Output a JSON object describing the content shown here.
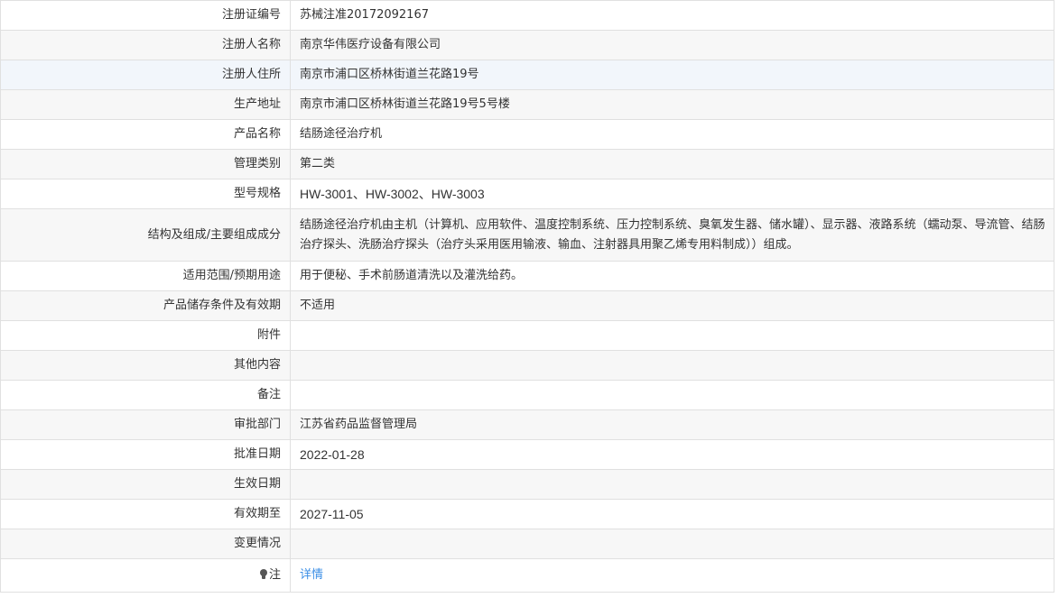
{
  "rows": [
    {
      "label": "注册证编号",
      "value": "苏械注准20172092167"
    },
    {
      "label": "注册人名称",
      "value": "南京华伟医疗设备有限公司"
    },
    {
      "label": "注册人住所",
      "value": "南京市浦口区桥林街道兰花路19号"
    },
    {
      "label": "生产地址",
      "value": "南京市浦口区桥林街道兰花路19号5号楼"
    },
    {
      "label": "产品名称",
      "value": "结肠途径治疗机"
    },
    {
      "label": "管理类别",
      "value": "第二类"
    },
    {
      "label": "型号规格",
      "value": "HW-3001、HW-3002、HW-3003"
    },
    {
      "label": "结构及组成/主要组成成分",
      "value": "结肠途径治疗机由主机（计算机、应用软件、温度控制系统、压力控制系统、臭氧发生器、储水罐）、显示器、液路系统（蠕动泵、导流管、结肠治疗探头、洗肠治疗探头（治疗头采用医用输液、输血、注射器具用聚乙烯专用料制成））组成。"
    },
    {
      "label": "适用范围/预期用途",
      "value": "用于便秘、手术前肠道清洗以及灌洗给药。"
    },
    {
      "label": "产品储存条件及有效期",
      "value": "不适用"
    },
    {
      "label": "附件",
      "value": ""
    },
    {
      "label": "其他内容",
      "value": ""
    },
    {
      "label": "备注",
      "value": ""
    },
    {
      "label": "审批部门",
      "value": "江苏省药品监督管理局"
    },
    {
      "label": "批准日期",
      "value": "2022-01-28"
    },
    {
      "label": "生效日期",
      "value": ""
    },
    {
      "label": "有效期至",
      "value": "2027-11-05"
    },
    {
      "label": "变更情况",
      "value": ""
    }
  ],
  "note": {
    "label": "注",
    "icon": "lightbulb-icon",
    "link_text": "详情",
    "link_color": "#3a8ee6"
  }
}
